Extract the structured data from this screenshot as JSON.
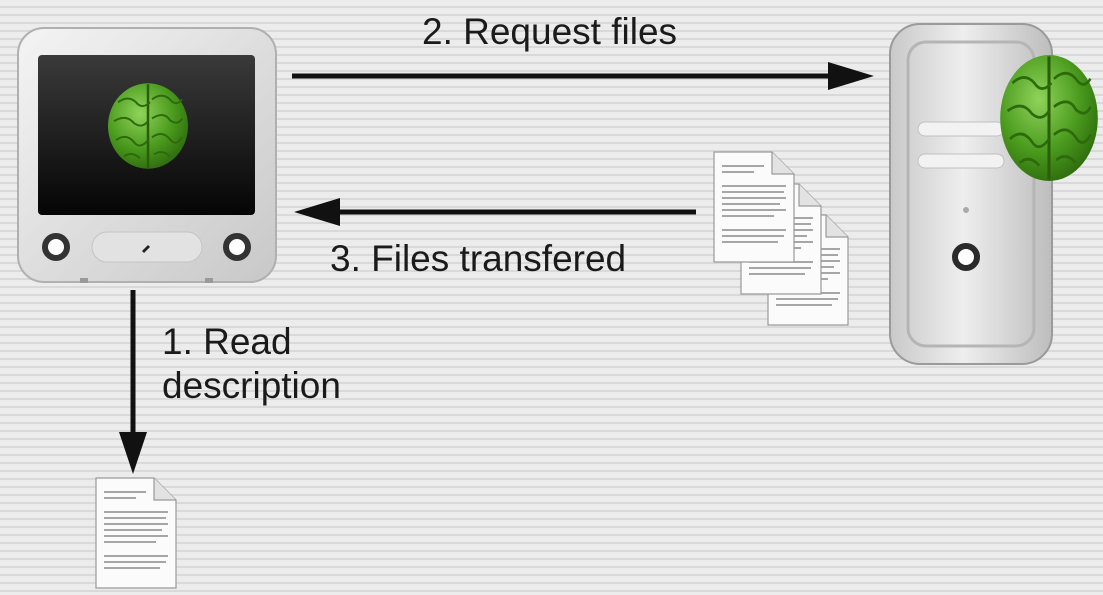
{
  "diagram": {
    "steps": [
      {
        "id": "read",
        "lines": [
          "1. Read",
          "description"
        ]
      },
      {
        "id": "request",
        "text": "2. Request files"
      },
      {
        "id": "transfer",
        "text": "3. Files transfered"
      }
    ],
    "nodes": [
      {
        "id": "client",
        "icon": "client-computer-icon"
      },
      {
        "id": "server",
        "icon": "server-tower-icon"
      },
      {
        "id": "description",
        "icon": "document-icon"
      },
      {
        "id": "files",
        "icon": "documents-stack-icon"
      }
    ],
    "colors": {
      "brain": "#4a9a1e",
      "arrow": "#111111",
      "background": "#e6e6e6"
    }
  }
}
